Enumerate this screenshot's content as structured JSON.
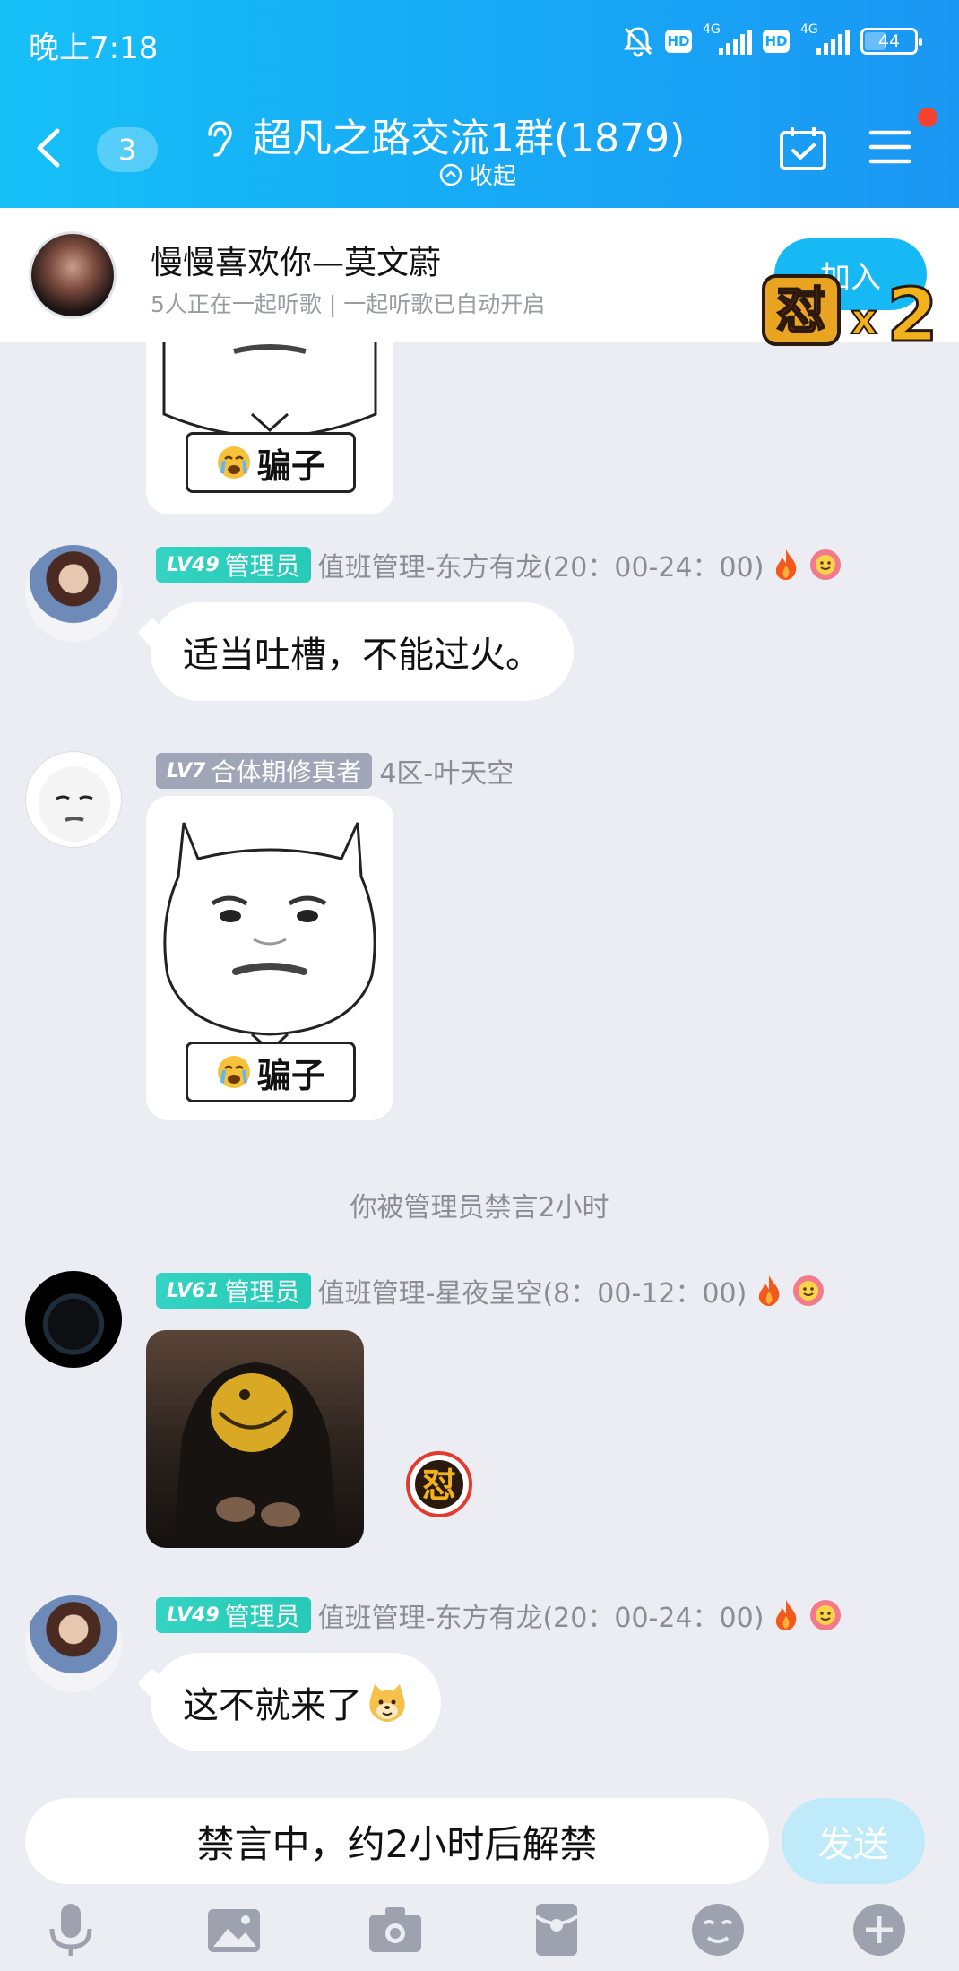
{
  "status_bar": {
    "time": "晚上7:18",
    "hd": "HD",
    "net": "4G",
    "battery": "44"
  },
  "nav": {
    "unread_count": "3",
    "group_title": "超凡之路交流1群(1879)",
    "collapse_label": "收起"
  },
  "listen": {
    "title": "慢慢喜欢你—莫文蔚",
    "subtitle": "5人正在一起听歌 | 一起听歌已自动开启",
    "join_label": "加入"
  },
  "messages": {
    "m1": {
      "level": "LV49",
      "role": "管理员",
      "nick": "值班管理-东方有龙(20：00-24：00)",
      "text": "适当吐槽，不能过火。"
    },
    "m2": {
      "level": "LV7",
      "role": "合体期修真者",
      "nick": "4区-叶天空",
      "sticker_label": "骗子"
    },
    "notice": "你被管理员禁言2小时",
    "m3": {
      "level": "LV61",
      "role": "管理员",
      "nick": "值班管理-星夜呈空(8：00-12：00)"
    },
    "m4": {
      "level": "LV49",
      "role": "管理员",
      "nick": "值班管理-东方有龙(20：00-24：00)",
      "text": "这不就来了"
    },
    "top_sticker_label": "骗子"
  },
  "input": {
    "muted_text": "禁言中，约2小时后解禁",
    "send_label": "发送"
  },
  "colors": {
    "header_start": "#16C0F7",
    "header_end": "#1A97F3",
    "admin_badge": "#27C9B7",
    "member_badge": "#A0A6B8",
    "send_disabled": "#BFEAF9",
    "background": "#ECEDF3"
  },
  "icons": [
    "back-icon",
    "ear-icon",
    "calendar-check-icon",
    "menu-icon",
    "flame-icon",
    "flower-icon",
    "mic-icon",
    "image-icon",
    "camera-icon",
    "red-packet-icon",
    "emoji-icon",
    "plus-icon"
  ]
}
